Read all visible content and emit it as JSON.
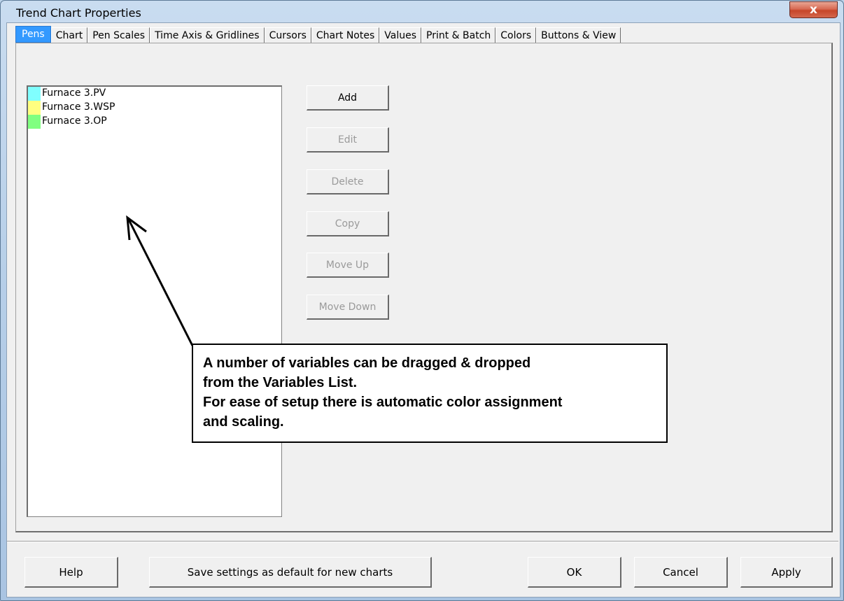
{
  "window": {
    "title": "Trend Chart Properties",
    "close_icon": "close-icon",
    "close_label": "x"
  },
  "tabs": [
    {
      "label": "Pens",
      "active": true
    },
    {
      "label": "Chart",
      "active": false
    },
    {
      "label": "Pen Scales",
      "active": false
    },
    {
      "label": "Time Axis & Gridlines",
      "active": false
    },
    {
      "label": "Cursors",
      "active": false
    },
    {
      "label": "Chart Notes",
      "active": false
    },
    {
      "label": "Values",
      "active": false
    },
    {
      "label": "Print & Batch",
      "active": false
    },
    {
      "label": "Colors",
      "active": false
    },
    {
      "label": "Buttons & View",
      "active": false
    }
  ],
  "pens": [
    {
      "label": "Furnace 3.PV",
      "color": "#80ffff"
    },
    {
      "label": "Furnace 3.WSP",
      "color": "#ffff80"
    },
    {
      "label": "Furnace 3.OP",
      "color": "#80ff80"
    }
  ],
  "side_buttons": {
    "add": "Add",
    "edit": "Edit",
    "delete": "Delete",
    "copy": "Copy",
    "move_up": "Move Up",
    "move_down": "Move Down"
  },
  "callout": {
    "line1": "A number of variables can be dragged & dropped",
    "line2": "from the Variables List.",
    "line3": "For ease of setup there is automatic color assignment",
    "line4": "and scaling."
  },
  "bottom_buttons": {
    "help": "Help",
    "save_default": "Save settings as default for new charts",
    "ok": "OK",
    "cancel": "Cancel",
    "apply": "Apply"
  },
  "colors": {
    "active_tab": "#3399ff",
    "close_button": "#c64629",
    "dialog_bg": "#f0f0f0"
  }
}
